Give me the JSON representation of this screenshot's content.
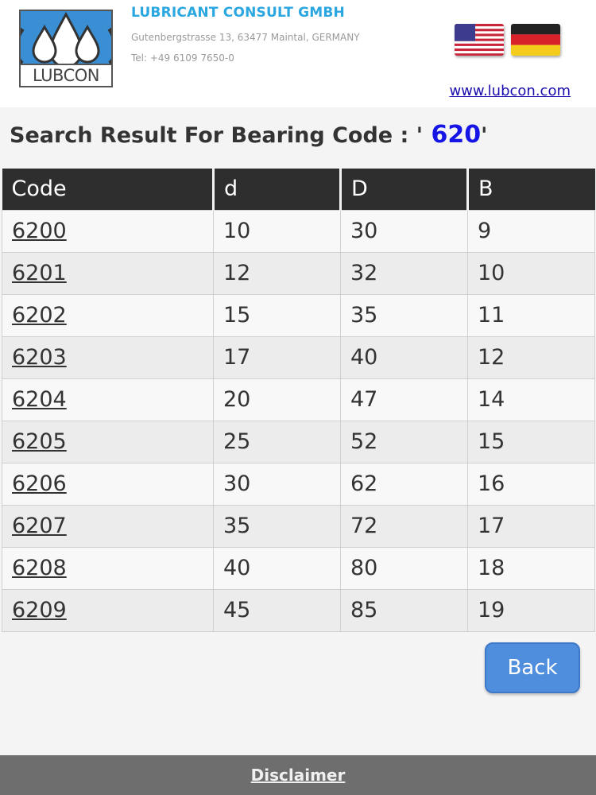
{
  "header": {
    "logo_text": "LUBCON",
    "company_name": "LUBRICANT CONSULT GMBH",
    "address": "Gutenbergstrasse 13, 63477 Maintal, GERMANY",
    "phone": "Tel: +49 6109 7650-0",
    "website": "www.lubcon.com"
  },
  "search": {
    "title_prefix": "Search Result For Bearing Code : '",
    "code": " 620",
    "title_suffix": "'"
  },
  "table": {
    "columns": [
      "Code",
      "d",
      "D",
      "B"
    ],
    "rows": [
      [
        "6200",
        "10",
        "30",
        "9"
      ],
      [
        "6201",
        "12",
        "32",
        "10"
      ],
      [
        "6202",
        "15",
        "35",
        "11"
      ],
      [
        "6203",
        "17",
        "40",
        "12"
      ],
      [
        "6204",
        "20",
        "47",
        "14"
      ],
      [
        "6205",
        "25",
        "52",
        "15"
      ],
      [
        "6206",
        "30",
        "62",
        "16"
      ],
      [
        "6207",
        "35",
        "72",
        "17"
      ],
      [
        "6208",
        "40",
        "80",
        "18"
      ],
      [
        "6209",
        "45",
        "85",
        "19"
      ]
    ]
  },
  "back_label": "Back",
  "footer": {
    "disclaimer": "Disclaimer"
  }
}
